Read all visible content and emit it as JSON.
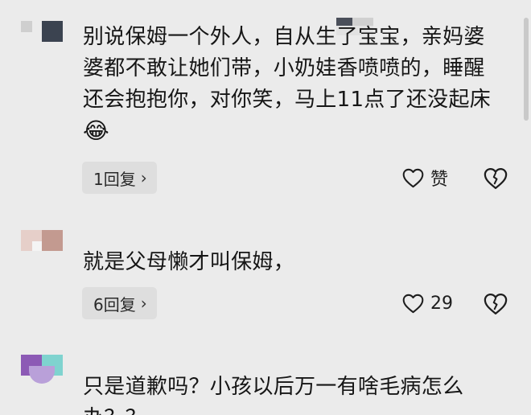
{
  "comments": [
    {
      "text_lines": [
        "别说保姆一个外人，自从生了宝宝，亲妈婆",
        "婆都不敢让她们带，小奶娃香喷喷的，睡醒",
        "还会抱抱你，对你笑，马上11点了还没起床"
      ],
      "emoji": "😂",
      "replies_label": "1回复",
      "like_label": "赞"
    },
    {
      "text_lines": [
        "就是父母懒才叫保姆，"
      ],
      "replies_label": "6回复",
      "like_label": "29"
    },
    {
      "text_lines": [
        "只是道歉吗？小孩以后万一有啥毛病怎么",
        "办？？"
      ]
    }
  ],
  "icons": {
    "like": "heart-outline-icon",
    "dislike": "broken-heart-icon",
    "chevron": "chevron-right-icon"
  },
  "colors": {
    "background": "#ebebeb",
    "reply_pill": "#dedede",
    "text": "#161616"
  }
}
